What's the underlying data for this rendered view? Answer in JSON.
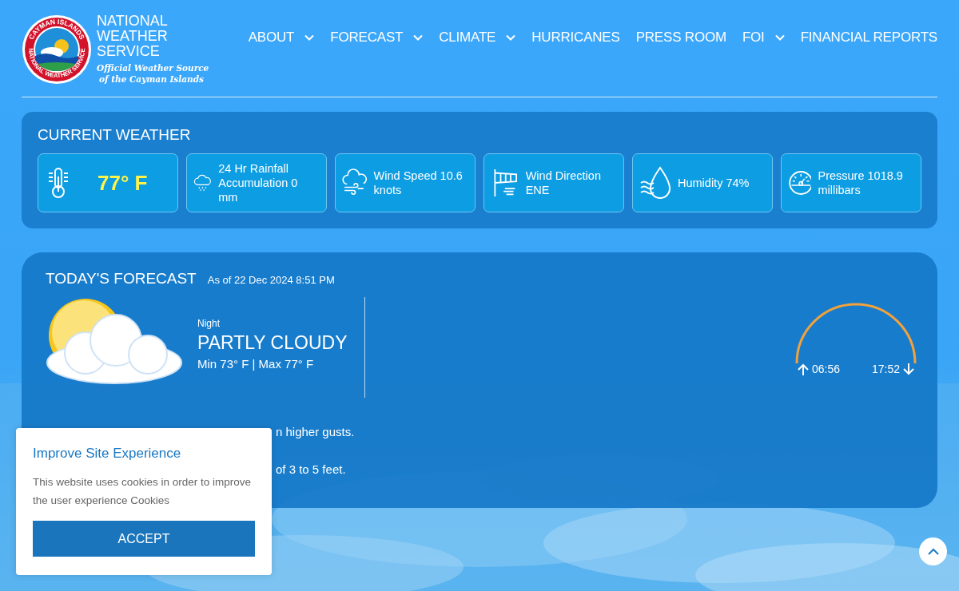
{
  "logo": {
    "ring_top": "CAYMAN ISLANDS",
    "ring_bottom": "NATIONAL WEATHER SERVICE",
    "title": "NATIONAL WEATHER SERVICE",
    "tagline_1": "Official Weather Source",
    "tagline_2": "of the Cayman Islands"
  },
  "nav": [
    {
      "label": "ABOUT",
      "dropdown": true
    },
    {
      "label": "FORECAST",
      "dropdown": true
    },
    {
      "label": "CLIMATE",
      "dropdown": true
    },
    {
      "label": "HURRICANES",
      "dropdown": false
    },
    {
      "label": "PRESS ROOM",
      "dropdown": false
    },
    {
      "label": "FOI",
      "dropdown": true
    },
    {
      "label": "FINANCIAL REPORTS",
      "dropdown": false
    }
  ],
  "current_weather": {
    "title": "CURRENT WEATHER",
    "cards": [
      {
        "kind": "temperature",
        "text": "77° F"
      },
      {
        "kind": "rainfall",
        "text": "24 Hr Rainfall Accumulation 0 mm"
      },
      {
        "kind": "wind",
        "text": "Wind Speed 10.6 knots"
      },
      {
        "kind": "windsock",
        "text": "Wind Direction ENE"
      },
      {
        "kind": "humidity",
        "text": "Humidity 74%"
      },
      {
        "kind": "pressure",
        "text": "Pressure 1018.9 millibars"
      }
    ]
  },
  "forecast": {
    "title": "TODAY'S FORECAST",
    "as_of": "As of 22 Dec 2024 8:51 PM",
    "period": "Night",
    "condition": "PARTLY CLOUDY",
    "min_max": "Min 73° F | Max 77° F",
    "sunrise": "06:56",
    "sunset": "17:52",
    "lines": [
      "n higher gusts.",
      "of 3 to 5 feet."
    ]
  },
  "cookie": {
    "title": "Improve Site Experience",
    "text": "This website uses cookies in order to improve the user experience Cookies",
    "button": "ACCEPT"
  }
}
